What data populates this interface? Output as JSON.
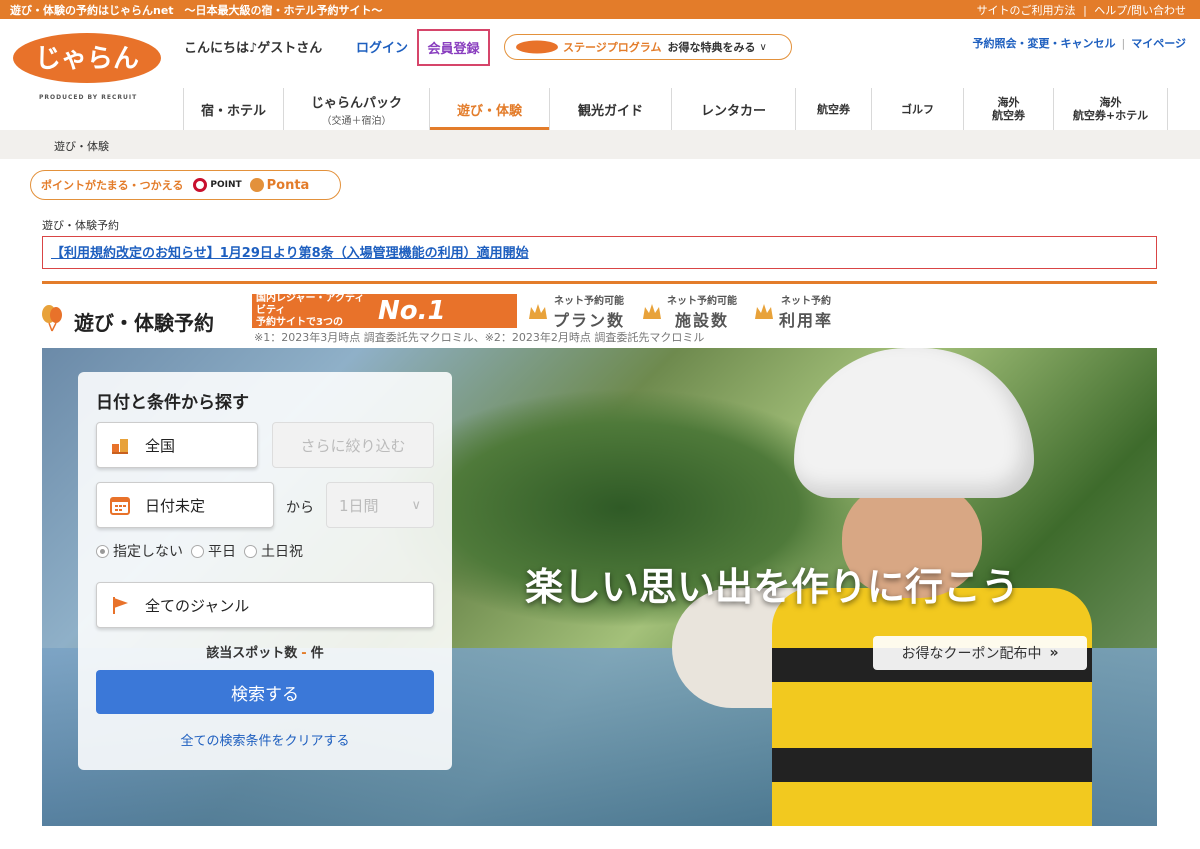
{
  "topbar": {
    "tagline": "遊び・体験の予約はじゃらんnet　〜日本最大級の宿・ホテル予約サイト〜",
    "link_usage": "サイトのご利用方法",
    "link_help": "ヘルプ/問い合わせ"
  },
  "header": {
    "logo_text": "じゃらん",
    "produced_by": "PRODUCED BY RECRUIT",
    "greeting": "こんにちは♪ゲストさん",
    "login": "ログイン",
    "register": "会員登録",
    "stage_label": "ステージプログラム",
    "stage_deal": "お得な特典をみる",
    "reservation": "予約照会・変更・キャンセル",
    "mypage": "マイページ"
  },
  "nav": {
    "tabs": [
      {
        "label": "宿・ホテル",
        "sub": ""
      },
      {
        "label": "じゃらんパック",
        "sub": "（交通＋宿泊）"
      },
      {
        "label": "遊び・体験",
        "sub": ""
      },
      {
        "label": "観光ガイド",
        "sub": ""
      },
      {
        "label": "レンタカー",
        "sub": ""
      },
      {
        "label": "航空券",
        "sub": ""
      },
      {
        "label": "ゴルフ",
        "sub": ""
      },
      {
        "label": "海外\n航空券",
        "sub": ""
      },
      {
        "label": "海外\n航空券+ホテル",
        "sub": ""
      }
    ],
    "active_index": 2
  },
  "breadcrumb": "遊び・体験",
  "points": {
    "text": "ポイントがたまる・つかえる",
    "dpoint": "POINT",
    "ponta": "Ponta"
  },
  "section_label": "遊び・体験予約",
  "notice": "【利用規約改定のお知らせ】1月29日より第8条（入場管理機能の利用）適用開始",
  "page_title": "遊び・体験予約",
  "award": {
    "lead_line1": "国内レジャー・アクティビティ",
    "lead_line2": "予約サイトで3つの",
    "no1": "No.1",
    "items": [
      {
        "top": "ネット予約可能",
        "main": "プラン数"
      },
      {
        "top": "ネット予約可能",
        "main": "施設数"
      },
      {
        "top": "ネット予約",
        "main": "利用率"
      }
    ],
    "footnote": "※1：2023年3月時点 調査委託先マクロミル、※2：2023年2月時点 調査委託先マクロミル"
  },
  "hero": {
    "tagline": "楽しい思い出を作りに行こう",
    "coupon": "お得なクーポン配布中"
  },
  "search": {
    "title": "日付と条件から探す",
    "area": "全国",
    "refine_placeholder": "さらに絞り込む",
    "date": "日付未定",
    "kara": "から",
    "days": "1日間",
    "radios": [
      {
        "label": "指定しない",
        "checked": true
      },
      {
        "label": "平日",
        "checked": false
      },
      {
        "label": "土日祝",
        "checked": false
      }
    ],
    "genre": "全てのジャンル",
    "count_label": "該当スポット数",
    "count_value": "-",
    "count_unit": "件",
    "search_button": "検索する",
    "clear_link": "全ての検索条件をクリアする"
  },
  "colors": {
    "brand_orange": "#e37c2a",
    "link_blue": "#1e5fbf",
    "search_blue": "#3b78d8",
    "alert_red": "#d94545"
  }
}
